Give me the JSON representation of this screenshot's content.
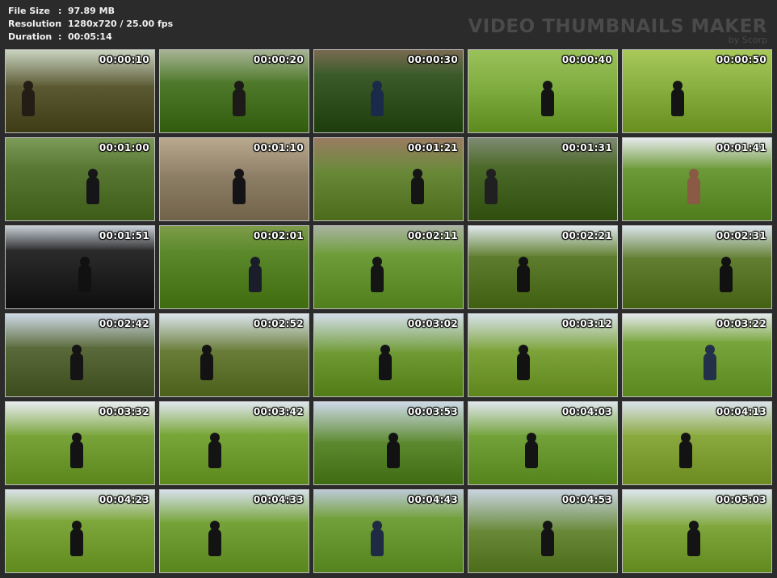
{
  "info": {
    "rows": [
      {
        "key": "File Size",
        "sep": ":",
        "value": "97.89 MB"
      },
      {
        "key": "Resolution",
        "sep": ":",
        "value": "1280x720 / 25.00 fps"
      },
      {
        "key": "Duration",
        "sep": ":",
        "value": "00:05:14"
      }
    ]
  },
  "brand": {
    "title": "VIDEO THUMBNAILS MAKER",
    "subtitle": "by Scorp"
  },
  "thumbnails": [
    {
      "time": "00:00:10",
      "sky": "#c9d3c0",
      "ground": "#5b5a33",
      "dark": "#231d16"
    },
    {
      "time": "00:00:20",
      "sky": "#a7b495",
      "ground": "#4f7a2b",
      "dark": "#1d1b17"
    },
    {
      "time": "00:00:30",
      "sky": "#7a6a52",
      "ground": "#3b5c2a",
      "dark": "#1a2a4a"
    },
    {
      "time": "00:00:40",
      "sky": "#9ac25a",
      "ground": "#7aa83a",
      "dark": "#141414"
    },
    {
      "time": "00:00:50",
      "sky": "#a8c85a",
      "ground": "#86ad3e",
      "dark": "#141414"
    },
    {
      "time": "00:01:00",
      "sky": "#7c9a58",
      "ground": "#5a7a36",
      "dark": "#161618"
    },
    {
      "time": "00:01:10",
      "sky": "#b9a98e",
      "ground": "#8f8068",
      "dark": "#141416"
    },
    {
      "time": "00:01:21",
      "sky": "#9a7c62",
      "ground": "#6a8a3a",
      "dark": "#151515"
    },
    {
      "time": "00:01:31",
      "sky": "#7e8a72",
      "ground": "#4d6b2a",
      "dark": "#202020"
    },
    {
      "time": "00:01:41",
      "sky": "#e6e9ec",
      "ground": "#6e9b3a",
      "dark": "#8a5a44"
    },
    {
      "time": "00:01:51",
      "sky": "#c8cfd6",
      "ground": "#2c2c2c",
      "dark": "#111111"
    },
    {
      "time": "00:02:01",
      "sky": "#7e9c4a",
      "ground": "#5d8a2c",
      "dark": "#1a1d2a"
    },
    {
      "time": "00:02:11",
      "sky": "#a9b4a0",
      "ground": "#6e9d3a",
      "dark": "#151515"
    },
    {
      "time": "00:02:21",
      "sky": "#dfe7ec",
      "ground": "#5e7d2e",
      "dark": "#121212"
    },
    {
      "time": "00:02:31",
      "sky": "#d9e3ea",
      "ground": "#637f32",
      "dark": "#111111"
    },
    {
      "time": "00:02:42",
      "sky": "#cdd9e6",
      "ground": "#5a6a3a",
      "dark": "#141414"
    },
    {
      "time": "00:02:52",
      "sky": "#dbe4ec",
      "ground": "#6a7e3a",
      "dark": "#131313"
    },
    {
      "time": "00:03:02",
      "sky": "#d3dee9",
      "ground": "#6f9a34",
      "dark": "#131316"
    },
    {
      "time": "00:03:12",
      "sky": "#d8e2ea",
      "ground": "#7da43a",
      "dark": "#121212"
    },
    {
      "time": "00:03:22",
      "sky": "#e4e9ec",
      "ground": "#78a63c",
      "dark": "#23304a"
    },
    {
      "time": "00:03:32",
      "sky": "#e8ecef",
      "ground": "#78a43a",
      "dark": "#131313"
    },
    {
      "time": "00:03:42",
      "sky": "#dee6ed",
      "ground": "#7aa73a",
      "dark": "#141414"
    },
    {
      "time": "00:03:53",
      "sky": "#cdd9e6",
      "ground": "#5d8a30",
      "dark": "#121212"
    },
    {
      "time": "00:04:03",
      "sky": "#dfe6ec",
      "ground": "#73a23a",
      "dark": "#141414"
    },
    {
      "time": "00:04:13",
      "sky": "#d9e2ea",
      "ground": "#8aa93e",
      "dark": "#131313"
    },
    {
      "time": "00:04:23",
      "sky": "#d9e1e8",
      "ground": "#7fa83c",
      "dark": "#131313"
    },
    {
      "time": "00:04:33",
      "sky": "#d6e0ea",
      "ground": "#77a43a",
      "dark": "#131313"
    },
    {
      "time": "00:04:43",
      "sky": "#bcc9d6",
      "ground": "#72a03a",
      "dark": "#1f2a44"
    },
    {
      "time": "00:04:53",
      "sky": "#c9d4df",
      "ground": "#6a8a3a",
      "dark": "#141414"
    },
    {
      "time": "00:05:03",
      "sky": "#dce5ec",
      "ground": "#7fa73c",
      "dark": "#141414"
    }
  ]
}
